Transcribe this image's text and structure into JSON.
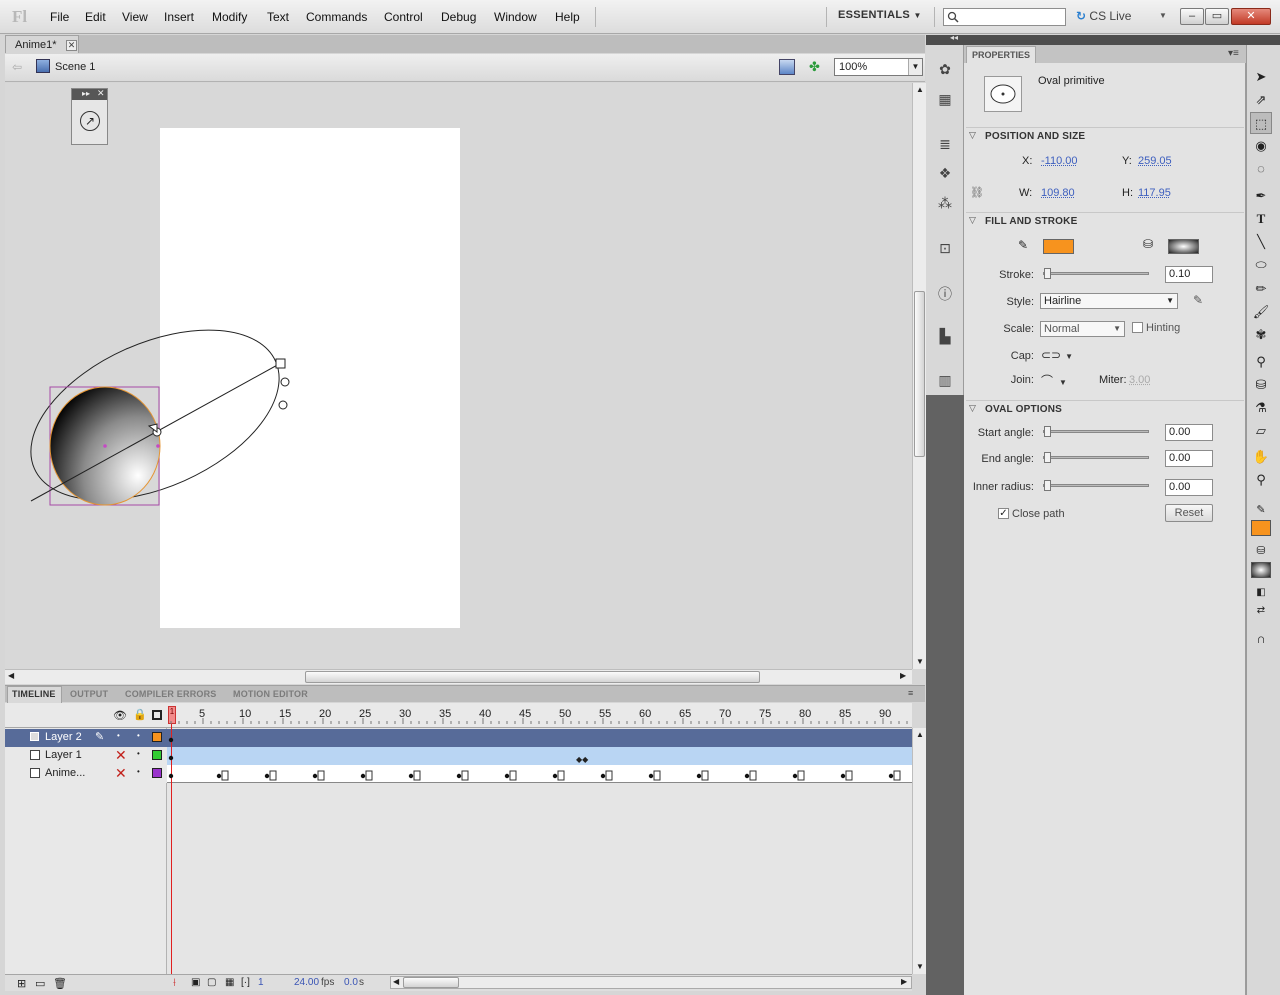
{
  "app": {
    "logo": "Fl",
    "workspace": "ESSENTIALS",
    "cs_live": "CS Live",
    "window_buttons": [
      "–",
      "▭",
      "✕"
    ]
  },
  "menu": [
    "File",
    "Edit",
    "View",
    "Insert",
    "Modify",
    "Text",
    "Commands",
    "Control",
    "Debug",
    "Window",
    "Help"
  ],
  "document": {
    "tab_label": "Anime1*",
    "scene_label": "Scene 1",
    "zoom": "100%"
  },
  "timeline": {
    "tabs": [
      "TIMELINE",
      "OUTPUT",
      "COMPILER ERRORS",
      "MOTION EDITOR"
    ],
    "frame_numbers": [
      "5",
      "10",
      "15",
      "20",
      "25",
      "30",
      "35",
      "40",
      "45",
      "50",
      "55",
      "60",
      "65",
      "70",
      "75",
      "80",
      "85",
      "90"
    ],
    "playhead_frame": "1",
    "layers": [
      {
        "name": "Layer 2",
        "color": "#f7931e",
        "selected": true
      },
      {
        "name": "Layer 1",
        "color": "#33cc33",
        "selected": false
      },
      {
        "name": "Anime...",
        "color": "#9933cc",
        "selected": false
      }
    ],
    "footer": {
      "current_frame": "1",
      "fps": "24.00",
      "fps_unit": "fps",
      "time": "0.0",
      "time_unit": "s"
    }
  },
  "properties": {
    "tab": "PROPERTIES",
    "object_type": "Oval primitive",
    "position_size": {
      "title": "POSITION AND SIZE",
      "x_label": "X:",
      "x": "-110.00",
      "y_label": "Y:",
      "y": "259.05",
      "w_label": "W:",
      "w": "109.80",
      "h_label": "H:",
      "h": "117.95"
    },
    "fill_stroke": {
      "title": "FILL AND STROKE",
      "stroke_color": "#f7931e",
      "stroke_label": "Stroke:",
      "stroke": "0.10",
      "style_label": "Style:",
      "style": "Hairline",
      "scale_label": "Scale:",
      "scale": "Normal",
      "hinting_label": "Hinting",
      "cap_label": "Cap:",
      "join_label": "Join:",
      "miter_label": "Miter:",
      "miter": "3.00"
    },
    "oval_options": {
      "title": "OVAL OPTIONS",
      "start_label": "Start angle:",
      "start": "0.00",
      "end_label": "End angle:",
      "end": "0.00",
      "inner_label": "Inner radius:",
      "inner": "0.00",
      "close_path_label": "Close path",
      "reset_label": "Reset"
    }
  },
  "colors": {
    "accent_orange": "#f7931e",
    "layer_selected": "#576b99",
    "frames_blue": "#b9d5f3"
  }
}
